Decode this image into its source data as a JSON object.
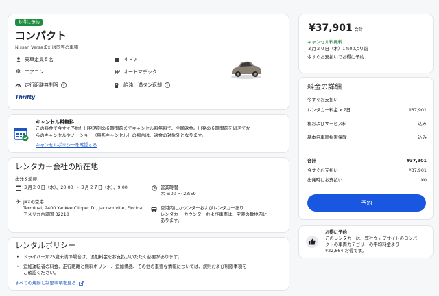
{
  "car": {
    "badge": "お得に予約",
    "title": "コンパクト",
    "subtitle": "Nissan Versaまたは同等の車種",
    "features": [
      {
        "icon": "person-icon",
        "label": "乗車定員５名"
      },
      {
        "icon": "car-door-icon",
        "label": "４ドア"
      },
      {
        "icon": "snowflake-icon",
        "label": "エアコン"
      },
      {
        "icon": "gearshift-icon",
        "label": "オートマチック"
      },
      {
        "icon": "speedometer-icon",
        "label": "走行距離無制限"
      },
      {
        "icon": "fuel-pump-icon",
        "label": "給油：満タン返却"
      }
    ],
    "vendor_logo": "Thrifty"
  },
  "cancel": {
    "title": "キャンセル料無料",
    "body_1": "この料金で今すぐ予約！出発時刻の６時間前までキャンセル料無料で、全額返金。出発の６時間前を過ぎてか",
    "body_2": "らのキャンセルやノーショー（無断キャンセル）の場合は、返金の対象外となります。",
    "link": "キャンセルポリシーを確認する"
  },
  "location": {
    "title": "レンタカー会社の所在地",
    "sub": "出発＆返却",
    "dates": "３月２０日（木）、20:00 ～ ３月２７日（木）、9:00",
    "hours_label": "営業時間",
    "hours": "木 6:00 ～ 23:59",
    "airport": "JAXの空港",
    "address_1": "Terminal, 2400 Yankee Clipper Dr, Jacksonville, Florida,",
    "address_2": "アメリカ合衆国 32218",
    "counter_1": "空港内にカウンターおよびレンタカーあり",
    "counter_2": "レンタカー カウンターおよび車両は、空港の敷地内に",
    "counter_3": "あります。"
  },
  "policy": {
    "title": "レンタルポリシー",
    "item_1": "ドライバーが25歳未満の場合は、追加料金をお支払いいただく必要があります。",
    "item_2a": "追加運転者の料金、走行距離と燃料ポリシー、追加備品、その他の重要な情報については、規則および制限事項を",
    "item_2b": "ご確認ください。",
    "link": "すべての規則と制限事項を見る"
  },
  "price": {
    "amount": "¥37,901",
    "unit": "合計",
    "free_cancel": "キャンセル料無料",
    "deadline": "３月２０日（木）14:00より前",
    "pay_now": "今すぐお支払いでお得に予約"
  },
  "details": {
    "title": "料金の詳細",
    "section": "今すぐお支払い",
    "rows": [
      {
        "label": "レンタカー料金 x 7日",
        "value": "¥37,901"
      },
      {
        "label": "税およびサービス料",
        "value": "込み"
      },
      {
        "label": "基本自車両損害保険",
        "value": "込み"
      }
    ],
    "total_label": "合計",
    "total_value": "¥37,901",
    "now_label": "今すぐお支払い",
    "now_value": "¥37,901",
    "depart_label": "出発時にお支払い",
    "depart_value": "¥0",
    "book_button": "予約"
  },
  "deal": {
    "title": "お得に予約",
    "line_1": "このレンタカーは、弊社ウェブサイトのコンパ",
    "line_2": "クトの車両カテゴリーの平均料金より",
    "line_3": "¥22,664 お得です。"
  },
  "colors": {
    "accent": "#1a73e8",
    "badge": "#1e8e3e",
    "button": "#1a57e0"
  }
}
